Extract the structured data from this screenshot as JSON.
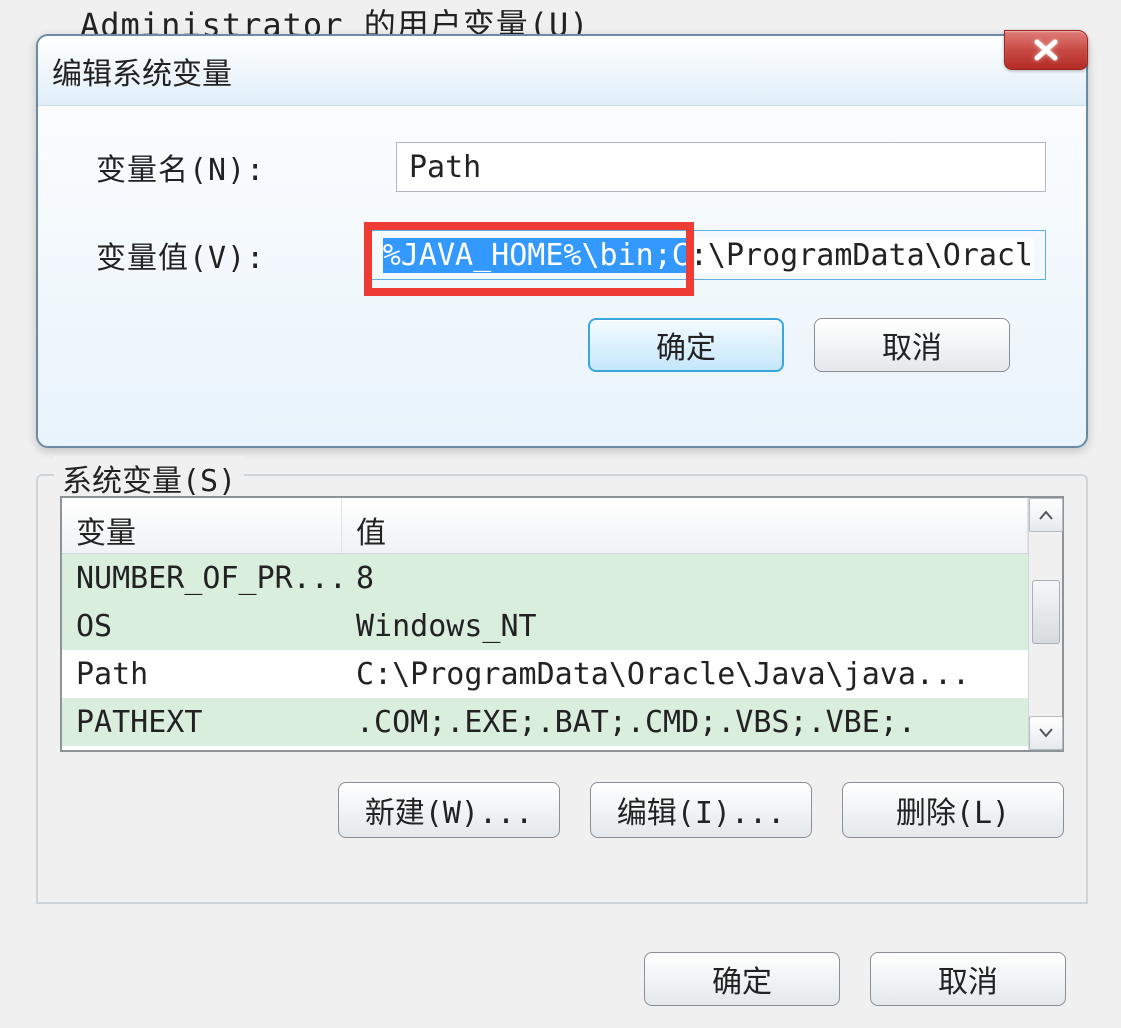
{
  "background_hint_text": "Administrator 的用户变量(U)",
  "dialog": {
    "title": "编辑系统变量",
    "name_label": "变量名(N):",
    "name_value": "Path",
    "value_label": "变量值(V):",
    "value_selected_part": "%JAVA_HOME%\\bin;C",
    "value_rest_part": ":\\ProgramData\\Oracl",
    "close_icon": "✕",
    "ok_button": "确定",
    "cancel_button": "取消"
  },
  "group": {
    "title": "系统变量(S)",
    "header_variable": "变量",
    "header_value": "值",
    "rows": [
      {
        "var": "NUMBER_OF_PR...",
        "val": "8",
        "alt": true
      },
      {
        "var": "OS",
        "val": "Windows_NT",
        "alt": true
      },
      {
        "var": "Path",
        "val": "C:\\ProgramData\\Oracle\\Java\\java...",
        "alt": false
      },
      {
        "var": "PATHEXT",
        "val": ".COM;.EXE;.BAT;.CMD;.VBS;.VBE;.",
        "alt": true
      }
    ],
    "new_button": "新建(W)...",
    "edit_button": "编辑(I)...",
    "delete_button": "删除(L)"
  },
  "bottom": {
    "ok_button": "确定",
    "cancel_button": "取消"
  },
  "colors": {
    "highlight_border": "#ee3b34",
    "selection_bg": "#3399ff",
    "alt_row_bg": "#daeedd",
    "primary_button_border": "#3aa6de"
  }
}
